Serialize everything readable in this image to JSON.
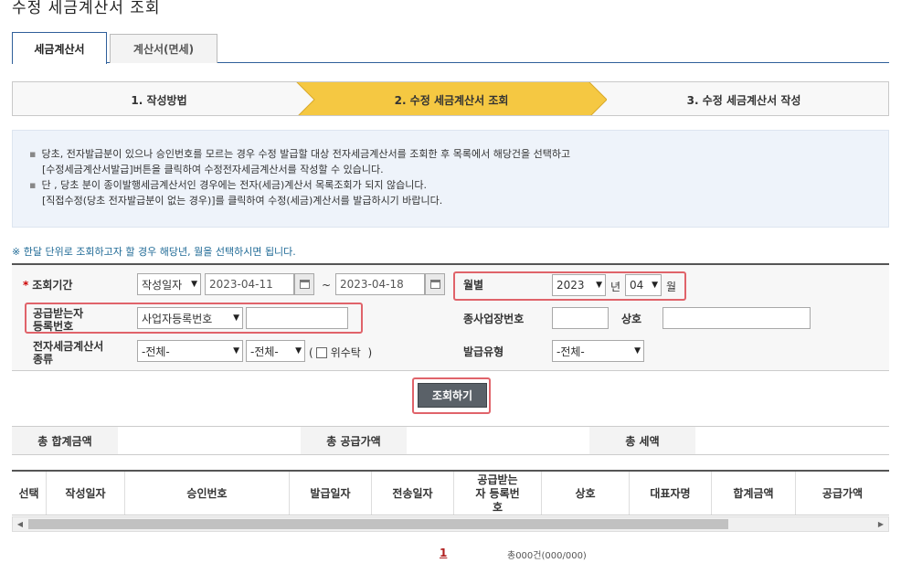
{
  "page": {
    "title": "수정 세금계산서 조회"
  },
  "tabs": [
    {
      "label": "세금계산서",
      "active": true
    },
    {
      "label": "계산서(면세)",
      "active": false
    }
  ],
  "steps": [
    {
      "label": "1. 작성방법"
    },
    {
      "label": "2. 수정 세금계산서 조회",
      "active": true
    },
    {
      "label": "3. 수정 세금계산서 작성"
    }
  ],
  "info": {
    "line1": "당초, 전자발급분이 있으나 승인번호를 모르는 경우 수정 발급할 대상 전자세금계산서를 조회한 후 목록에서 해당건을 선택하고",
    "line2": "[수정세금계산서발급]버튼을 클릭하여 수정전자세금계산서를 작성할 수 있습니다.",
    "line3": "단 , 당초 분이 종이발행세금계산서인 경우에는 전자(세금)계산서 목록조회가 되지 않습니다.",
    "line4": "[직접수정(당초 전자발급분이 없는 경우)]를 클릭하여 수정(세금)계산서를 발급하시기 바랍니다."
  },
  "notice": "※ 한달 단위로 조회하고자 할 경우 해당년, 월을 선택하시면 됩니다.",
  "search": {
    "period_label": "조회기간",
    "period_type": "작성일자",
    "date_from": "2023-04-11",
    "tilde": "~",
    "date_to": "2023-04-18",
    "monthly_label": "월별",
    "year": "2023",
    "year_unit": "년",
    "month": "04",
    "month_unit": "월",
    "recipient_label_1": "공급받는자",
    "recipient_label_2": "등록번호",
    "recipient_type": "사업자등록번호",
    "recipient_value": "",
    "branch_label": "종사업장번호",
    "branch_value": "",
    "company_label": "상호",
    "company_value": "",
    "kind_label_1": "전자세금계산서",
    "kind_label_2": "종류",
    "kind_select_1": "-전체-",
    "kind_select_2": "-전체-",
    "consign_open": "(",
    "consign_label": "위수탁",
    "consign_close": ")",
    "issue_type_label": "발급유형",
    "issue_type": "-전체-",
    "button": "조회하기"
  },
  "totals": {
    "sum_label": "총 합계금액",
    "supply_label": "총 공급가액",
    "tax_label": "총 세액"
  },
  "grid": {
    "columns": [
      "선택",
      "작성일자",
      "승인번호",
      "발급일자",
      "전송일자",
      "공급받는자 등록번호",
      "상호",
      "대표자명",
      "합계금액",
      "공급가액"
    ]
  },
  "pager": {
    "current": "1",
    "count": "총000건(000/000)"
  },
  "colors": {
    "highlight": "#e0636a",
    "step_active": "#f5c842",
    "tab_border": "#2f5f9a"
  }
}
